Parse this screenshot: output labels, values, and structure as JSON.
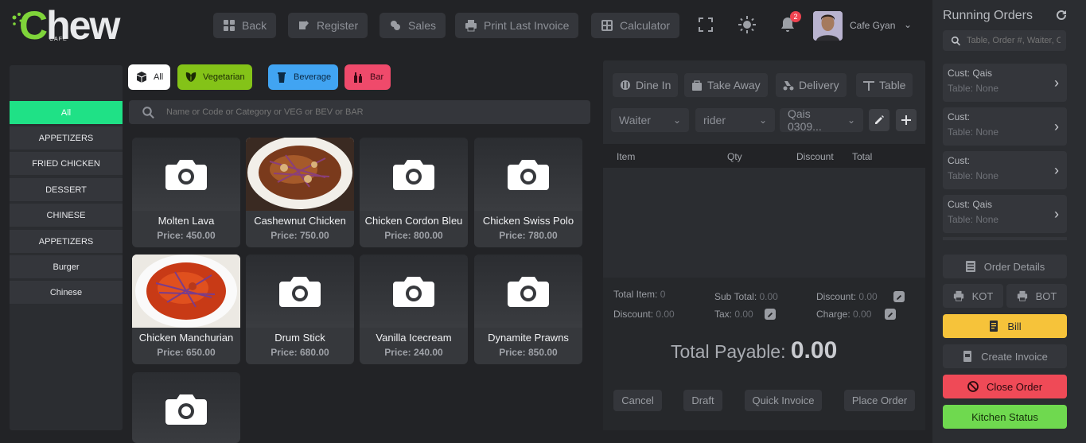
{
  "header": {
    "logo_text_1": "C",
    "logo_text_2": "hew",
    "logo_sub": "CAFE",
    "buttons": [
      {
        "label": "Back",
        "icon": "grid-icon"
      },
      {
        "label": "Register",
        "icon": "register-icon"
      },
      {
        "label": "Sales",
        "icon": "coins-icon"
      },
      {
        "label": "Print Last Invoice",
        "icon": "printer-icon"
      },
      {
        "label": "Calculator",
        "icon": "calculator-icon"
      }
    ],
    "notification_count": "2",
    "user_name": "Cafe Gyan"
  },
  "filters": [
    {
      "label": "All",
      "color": "#ffffff",
      "text_color": "#222326"
    },
    {
      "label": "Vegetarian",
      "color": "#84c318",
      "text_color": "#1c2a05"
    },
    {
      "label": "Beverage",
      "color": "#41a4f2",
      "text_color": "#0c2a44"
    },
    {
      "label": "Bar",
      "color": "#ef4a6b",
      "text_color": "#3a0814"
    }
  ],
  "search": {
    "placeholder": "Name or Code or Category or VEG or BEV or BAR"
  },
  "categories": [
    "All",
    "APPETIZERS",
    "FRIED CHICKEN",
    "DESSERT",
    "CHINESE",
    "APPETIZERS",
    "Burger",
    "Chinese"
  ],
  "products": [
    {
      "name": "Molten Lava",
      "price": "Price: 450.00",
      "image": "camera-icon"
    },
    {
      "name": "Cashewnut Chicken",
      "price": "Price: 750.00",
      "image": "dish-photo"
    },
    {
      "name": "Chicken Cordon Bleu",
      "price": "Price: 800.00",
      "image": "camera-icon"
    },
    {
      "name": "Chicken Swiss Polo",
      "price": "Price: 780.00",
      "image": "camera-icon"
    },
    {
      "name": "Chicken Manchurian",
      "price": "Price: 650.00",
      "image": "dish-photo"
    },
    {
      "name": "Drum Stick",
      "price": "Price: 680.00",
      "image": "camera-icon"
    },
    {
      "name": "Vanilla Icecream",
      "price": "Price: 240.00",
      "image": "camera-icon"
    },
    {
      "name": "Dynamite Prawns",
      "price": "Price: 850.00",
      "image": "camera-icon"
    },
    {
      "name": "",
      "price": "",
      "image": "camera-icon"
    }
  ],
  "order": {
    "tabs": [
      "Dine In",
      "Take Away",
      "Delivery",
      "Table"
    ],
    "waiter": "Waiter",
    "rider": "rider",
    "customer": "Qais 0309...",
    "columns": [
      "Item",
      "Qty",
      "Discount",
      "Total"
    ],
    "summary": {
      "total_item_label": "Total Item:",
      "total_item": "0",
      "sub_total_label": "Sub Total:",
      "sub_total": "0.00",
      "discount_label": "Discount:",
      "discount": "0.00",
      "discount2_label": "Discount:",
      "discount2": "0.00",
      "tax_label": "Tax:",
      "tax": "0.00",
      "charge_label": "Charge:",
      "charge": "0.00"
    },
    "total_payable_label": "Total Payable:",
    "total_payable": "0.00",
    "actions": [
      "Cancel",
      "Draft",
      "Quick Invoice",
      "Place Order"
    ]
  },
  "running_orders": {
    "title": "Running Orders",
    "search_placeholder": "Table, Order #, Waiter, Customer",
    "orders": [
      {
        "cust": "Cust: Qais",
        "table": "Table: None"
      },
      {
        "cust": "Cust:",
        "table": "Table: None"
      },
      {
        "cust": "Cust:",
        "table": "Table: None"
      },
      {
        "cust": "Cust: Qais",
        "table": "Table: None"
      }
    ],
    "buttons": {
      "order_details": "Order Details",
      "kot": "KOT",
      "bot": "BOT",
      "bill": "Bill",
      "create_invoice": "Create Invoice",
      "close_order": "Close Order",
      "kitchen_status": "Kitchen Status"
    }
  }
}
